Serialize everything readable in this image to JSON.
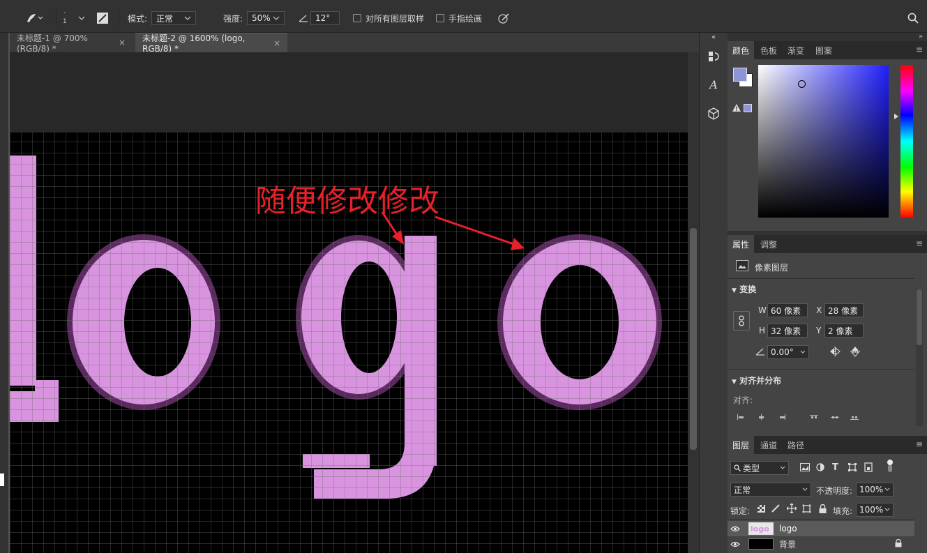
{
  "options": {
    "mode_label": "模式:",
    "mode_value": "正常",
    "strength_label": "强度:",
    "strength_value": "50%",
    "angle_value": "12°",
    "sample_all_layers": "对所有图层取样",
    "finger_painting": "手指绘画",
    "brush_size": "1"
  },
  "doc_tabs": [
    {
      "label": "未标题-1 @ 700%(RGB/8) *",
      "close": "×"
    },
    {
      "label": "未标题-2 @ 1600% (logo, RGB/8) *",
      "close": "×"
    }
  ],
  "canvas": {
    "annotation_text": "随便修改修改",
    "annotation_color": "#e8202a",
    "pixel_color": "#d994e0",
    "background_color": "#000000"
  },
  "color_panel": {
    "tabs": [
      "颜色",
      "色板",
      "渐变",
      "图案"
    ],
    "foreground": "#8e94d8",
    "background": "#ffffff"
  },
  "properties_panel": {
    "tabs": [
      "属性",
      "调整"
    ],
    "layer_type": "像素图层",
    "transform_title": "变换",
    "w_label": "W",
    "w_value": "60 像素",
    "x_label": "X",
    "x_value": "28 像素",
    "h_label": "H",
    "h_value": "32 像素",
    "y_label": "Y",
    "y_value": "2 像素",
    "angle_value": "0.00°",
    "align_title": "对齐并分布",
    "align_label": "对齐:"
  },
  "layers_panel": {
    "tabs": [
      "图层",
      "通道",
      "路径"
    ],
    "filter_label": "类型",
    "blend_mode": "正常",
    "opacity_label": "不透明度:",
    "opacity_value": "100%",
    "lock_label": "锁定:",
    "fill_label": "填充:",
    "fill_value": "100%",
    "layers": [
      {
        "name": "logo",
        "selected": true
      },
      {
        "name": "背景",
        "locked": true
      }
    ]
  }
}
